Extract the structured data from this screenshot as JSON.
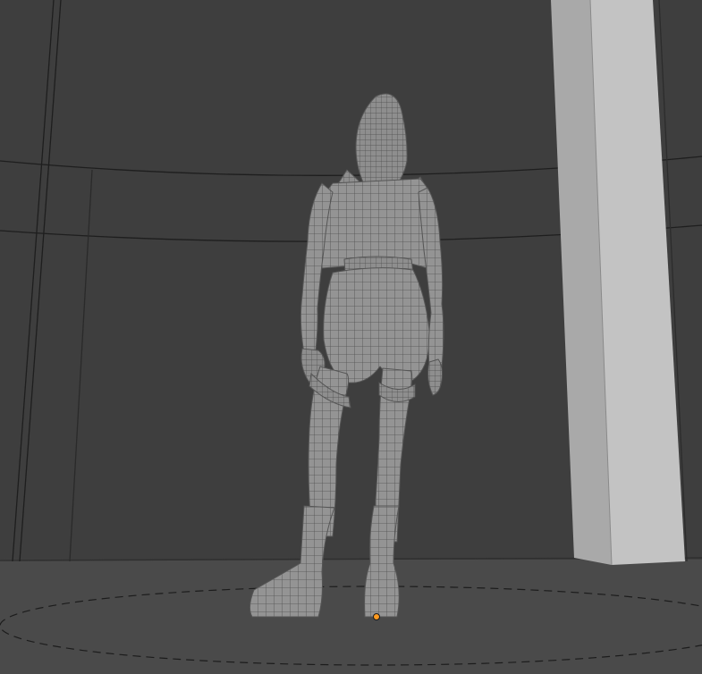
{
  "viewport": {
    "view": "3d-viewport",
    "shading": "wireframe-overlay",
    "colors": {
      "background": "#3d3d3d",
      "floor": "#4a4a4a",
      "mesh": "#8f8f8f",
      "wire": "#5a5a5a",
      "pillar_front": "#a8a8a8",
      "pillar_side": "#c4c4c4",
      "origin": "#ff9a1f"
    }
  },
  "scene": {
    "objects": [
      {
        "name": "character-mesh",
        "type": "mesh",
        "selected": false
      },
      {
        "name": "pillar",
        "type": "mesh",
        "selected": false
      },
      {
        "name": "floor-plane",
        "type": "mesh",
        "selected": false
      },
      {
        "name": "circle-guide",
        "type": "curve",
        "selected": false
      }
    ]
  }
}
